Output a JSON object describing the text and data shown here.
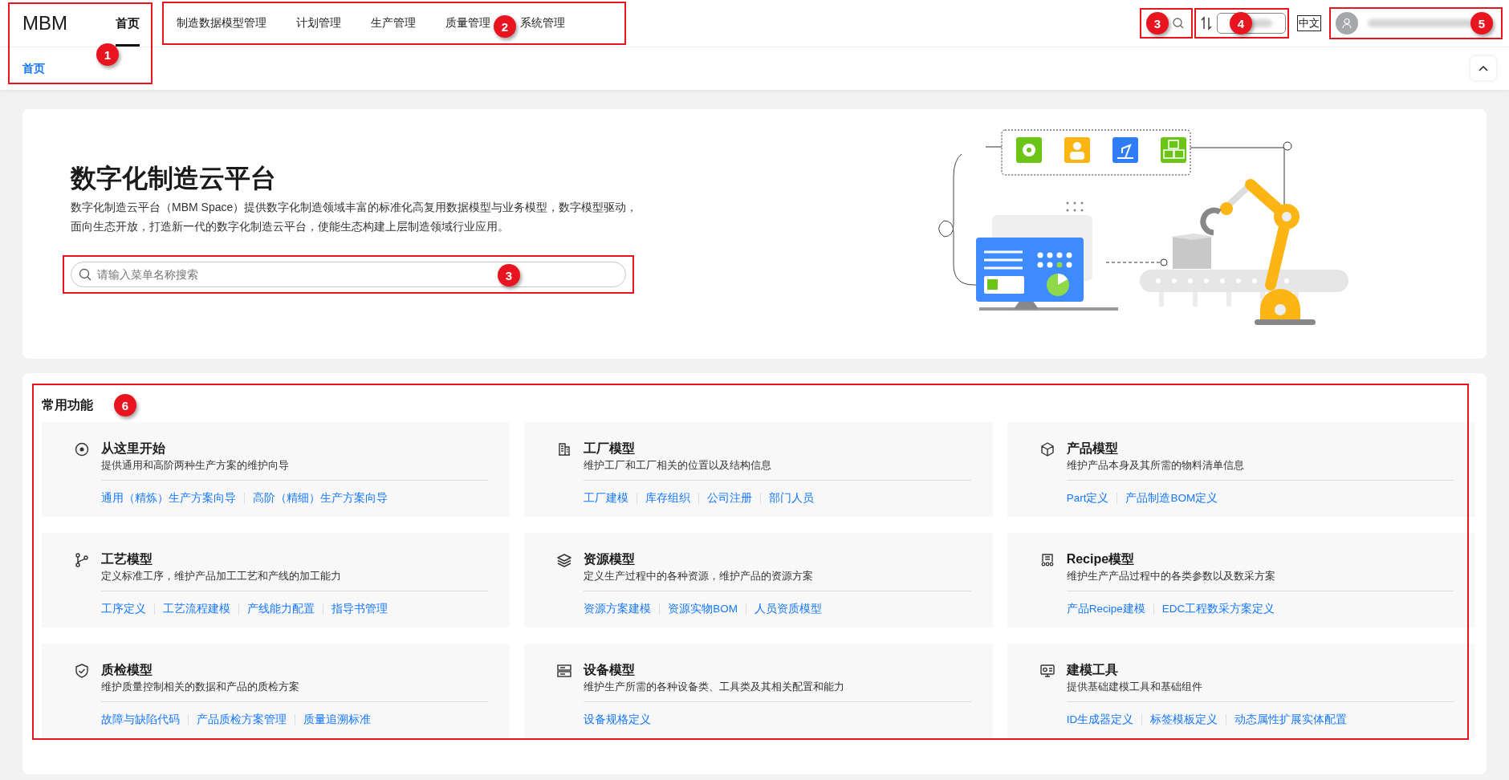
{
  "header": {
    "logo": "MBM",
    "home_tab": {
      "label": "首页",
      "selected": true
    },
    "home_callout": "1",
    "nav": {
      "callout": "2",
      "items": [
        {
          "label": "制造数据模型管理",
          "selected": false
        },
        {
          "label": "计划管理",
          "selected": false
        },
        {
          "label": "生产管理",
          "selected": false
        },
        {
          "label": "质量管理",
          "selected": false
        },
        {
          "label": "系统管理",
          "selected": false
        }
      ]
    },
    "search_callout": "3",
    "env_callout": "4",
    "language": {
      "label": "中文",
      "selected": true
    },
    "user_callout": "5"
  },
  "breadcrumb": [
    "首页"
  ],
  "hero": {
    "title": "数字化制造云平台",
    "description_lines": [
      "数字化制造云平台（MBM Space）提供数字化制造领域丰富的标准化高复用数据模型与业务模型，数字模型驱动，",
      "面向生态开放，打造新一代的数字化制造云平台，使能生态构建上层制造领域行业应用。"
    ],
    "search": {
      "placeholder": "请输入菜单名称搜索",
      "callout": "3"
    }
  },
  "features": {
    "title": "常用功能",
    "callout": "6",
    "cards": [
      {
        "kind": "target",
        "title": "从这里开始",
        "description": "提供通用和高阶两种生产方案的维护向导",
        "links": [
          "通用（精炼）生产方案向导",
          "高阶（精细）生产方案向导"
        ]
      },
      {
        "kind": "building",
        "title": "工厂模型",
        "description": "维护工厂和工厂相关的位置以及结构信息",
        "links": [
          "工厂建模",
          "库存组织",
          "公司注册",
          "部门人员"
        ]
      },
      {
        "kind": "cube",
        "title": "产品模型",
        "description": "维护产品本身及其所需的物料清单信息",
        "links": [
          "Part定义",
          "产品制造BOM定义"
        ]
      },
      {
        "kind": "branch",
        "title": "工艺模型",
        "description": "定义标准工序，维护产品加工工艺和产线的加工能力",
        "links": [
          "工序定义",
          "工艺流程建模",
          "产线能力配置",
          "指导书管理"
        ]
      },
      {
        "kind": "layers",
        "title": "资源模型",
        "description": "定义生产过程中的各种资源，维护产品的资源方案",
        "links": [
          "资源方案建模",
          "资源实物BOM",
          "人员资质模型"
        ]
      },
      {
        "kind": "recipe",
        "title": "Recipe模型",
        "description": "维护生产产品过程中的各类参数以及数采方案",
        "links": [
          "产品Recipe建模",
          "EDC工程数采方案定义"
        ]
      },
      {
        "kind": "shield",
        "title": "质检模型",
        "description": "维护质量控制相关的数据和产品的质检方案",
        "links": [
          "故障与缺陷代码",
          "产品质检方案管理",
          "质量追溯标准"
        ]
      },
      {
        "kind": "server",
        "title": "设备模型",
        "description": "维护生产所需的各种设备类、工具类及其相关配置和能力",
        "links": [
          "设备规格定义"
        ]
      },
      {
        "kind": "monitor",
        "title": "建模工具",
        "description": "提供基础建模工具和基础组件",
        "links": [
          "ID生成器定义",
          "标签模板定义",
          "动态属性扩展实体配置"
        ]
      }
    ]
  }
}
